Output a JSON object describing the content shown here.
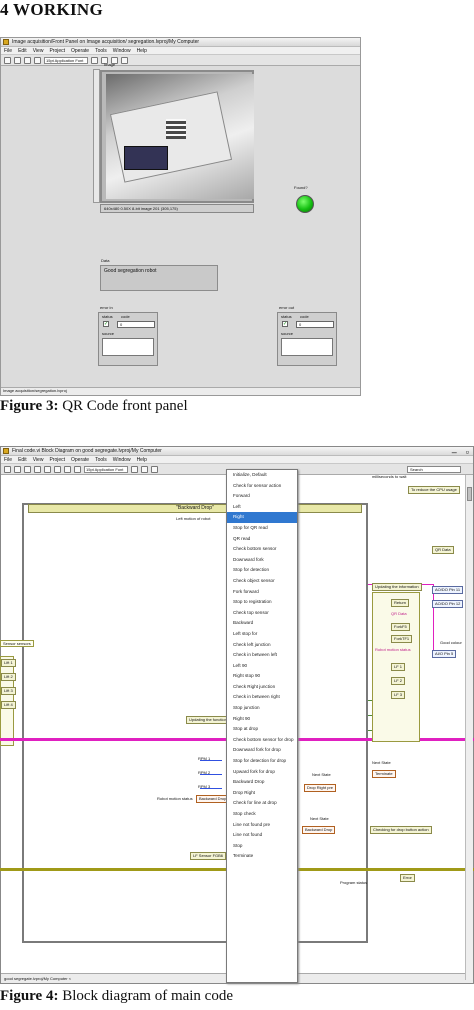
{
  "heading": "4 WORKING",
  "figure3": {
    "caption_label": "Figure 3:",
    "caption_text": "QR Code front panel",
    "window_title": "Image acquisition/Front Panel on Image acquisition/ segregation.lvproj/My Computer",
    "menu": [
      "File",
      "Edit",
      "View",
      "Project",
      "Operate",
      "Tools",
      "Window",
      "Help"
    ],
    "font_selector": "15pt Application Font",
    "image_label": "Image",
    "image_info": "640x480 0.50X 8-bit image 201    (305,175)",
    "found_label": "Found?",
    "found_value": true,
    "data_label": "Data",
    "data_value": "Good segregation robot",
    "error_in": {
      "title": "error in",
      "status_label": "status",
      "code_label": "code",
      "code": "0",
      "source_label": "source"
    },
    "error_out": {
      "title": "error out",
      "status_label": "status",
      "code_label": "code",
      "code": "0",
      "source_label": "source"
    },
    "status_bar": "Image acquisition/segregation.lvproj"
  },
  "figure4": {
    "caption_label": "Figure 4:",
    "caption_text": "Block diagram of main code",
    "window_title": "Final code.vi Block Diagram on good segregate.lvproj/My Computer",
    "menu": [
      "File",
      "Edit",
      "View",
      "Project",
      "Operate",
      "Tools",
      "Window",
      "Help"
    ],
    "font_selector": "15pt Application Font",
    "search_placeholder": "Search",
    "case_label": "\"Backward Drop\"",
    "case_sub": "Left motion of robot",
    "updating_label": "Updating the functions",
    "loop_top_note": "milliseconds to wait",
    "loop_note2": "To reduce the CPU usage",
    "updating_info": "Updating the information",
    "qr_data": "QR Data",
    "return_lbl": "Return",
    "qr_data2": "QR Data",
    "fork_f": "ForkF5",
    "fork_r": "ForkTF1",
    "robot_motion": "Robot motion status",
    "lf1": "LF 1",
    "lf2": "LF 2",
    "lf3": "LF 3",
    "good_color": "Good colour",
    "aio1": "AO/DO Pin 11",
    "aio2": "AO/DO Pin 12",
    "aio3": "AI/O Pin 5",
    "rpm_labels": [
      "RPM 1",
      "RPM 2",
      "RPM 3",
      "RPM 4"
    ],
    "robot_motion_status": "Robot motion status",
    "backward_drop": "Backward Drop",
    "ir_sensor": "LF Sensor FGB6",
    "next_state": "Next State",
    "drop_right": "Drop Right pre",
    "next_state2": "Next State",
    "backward_drop2": "Backward Drop",
    "terminate": "Terminate",
    "next_state3": "Next State",
    "checking_drop": "Checking for drop button action",
    "error_label": "Error",
    "prog_lbl": "Program status",
    "status_bar": "good segregate.lvproj/My Computer <",
    "left_column": [
      "Lift 1",
      "Lift 2",
      "Lift 3",
      "Lift 4"
    ],
    "left_title": "Sensor sensors",
    "dropdown_items": [
      "Initialize, Default",
      "Check for sensor action",
      "Forward",
      "Left",
      "Right",
      "Stop for QR read",
      "QR read",
      "Check bottom sensor",
      "Downward fork",
      "Stop for detection",
      "Check object sensor",
      "Fork forward",
      "Stop to registration",
      "Check top sensor",
      "Backward",
      "Left stop for",
      "Check left junction",
      "Check in between left",
      "Left 90",
      "Right stop 90",
      "Check Right junction",
      "Check in between right",
      "Stop junction",
      "Right 90",
      "Stop at drop",
      "Check bottom sensor for drop",
      "Downward fork for drop",
      "Stop for detection for drop",
      "Upward fork for drop",
      "Backward Drop",
      "Drop Right",
      "Check for line at drop",
      "Stop check",
      "Line not found pre",
      "Line not found",
      "Stop",
      "Terminate"
    ],
    "selected_item": "Right"
  }
}
